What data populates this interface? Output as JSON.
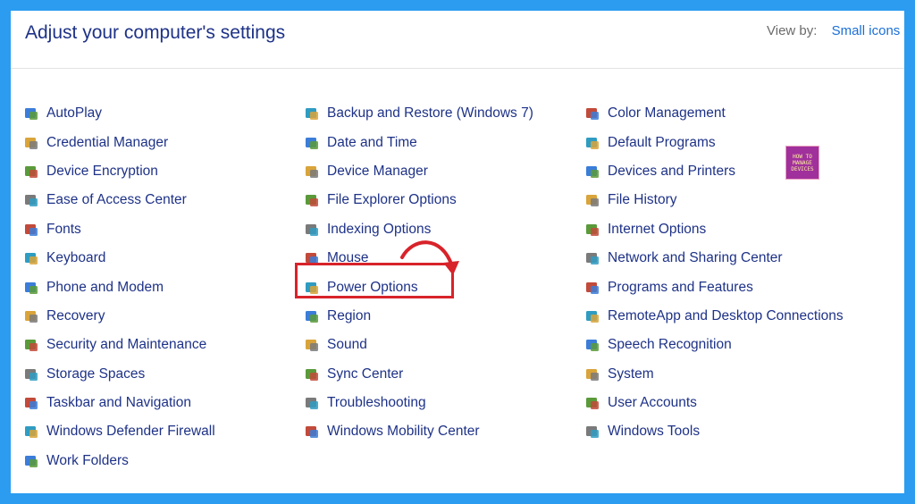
{
  "header": {
    "title": "Adjust your computer's settings",
    "view_by_label": "View by:",
    "view_by_value": "Small icons"
  },
  "columns": [
    [
      {
        "label": "AutoPlay",
        "icon": "autoplay-icon"
      },
      {
        "label": "Credential Manager",
        "icon": "credential-manager-icon"
      },
      {
        "label": "Device Encryption",
        "icon": "device-encryption-icon"
      },
      {
        "label": "Ease of Access Center",
        "icon": "ease-of-access-icon"
      },
      {
        "label": "Fonts",
        "icon": "fonts-icon"
      },
      {
        "label": "Keyboard",
        "icon": "keyboard-icon"
      },
      {
        "label": "Phone and Modem",
        "icon": "phone-modem-icon"
      },
      {
        "label": "Recovery",
        "icon": "recovery-icon"
      },
      {
        "label": "Security and Maintenance",
        "icon": "security-flag-icon"
      },
      {
        "label": "Storage Spaces",
        "icon": "storage-spaces-icon"
      },
      {
        "label": "Taskbar and Navigation",
        "icon": "taskbar-icon"
      },
      {
        "label": "Windows Defender Firewall",
        "icon": "firewall-icon"
      },
      {
        "label": "Work Folders",
        "icon": "work-folders-icon"
      }
    ],
    [
      {
        "label": "Backup and Restore (Windows 7)",
        "icon": "backup-restore-icon"
      },
      {
        "label": "Date and Time",
        "icon": "date-time-icon"
      },
      {
        "label": "Device Manager",
        "icon": "device-manager-icon"
      },
      {
        "label": "File Explorer Options",
        "icon": "file-explorer-options-icon"
      },
      {
        "label": "Indexing Options",
        "icon": "indexing-options-icon"
      },
      {
        "label": "Mouse",
        "icon": "mouse-icon"
      },
      {
        "label": "Power Options",
        "icon": "power-options-icon"
      },
      {
        "label": "Region",
        "icon": "region-icon"
      },
      {
        "label": "Sound",
        "icon": "sound-icon"
      },
      {
        "label": "Sync Center",
        "icon": "sync-center-icon"
      },
      {
        "label": "Troubleshooting",
        "icon": "troubleshooting-icon"
      },
      {
        "label": "Windows Mobility Center",
        "icon": "mobility-center-icon"
      }
    ],
    [
      {
        "label": "Color Management",
        "icon": "color-management-icon"
      },
      {
        "label": "Default Programs",
        "icon": "default-programs-icon"
      },
      {
        "label": "Devices and Printers",
        "icon": "devices-printers-icon"
      },
      {
        "label": "File History",
        "icon": "file-history-icon"
      },
      {
        "label": "Internet Options",
        "icon": "internet-options-icon"
      },
      {
        "label": "Network and Sharing Center",
        "icon": "network-sharing-icon"
      },
      {
        "label": "Programs and Features",
        "icon": "programs-features-icon"
      },
      {
        "label": "RemoteApp and Desktop Connections",
        "icon": "remoteapp-icon"
      },
      {
        "label": "Speech Recognition",
        "icon": "speech-recognition-icon"
      },
      {
        "label": "System",
        "icon": "system-icon"
      },
      {
        "label": "User Accounts",
        "icon": "user-accounts-icon"
      },
      {
        "label": "Windows Tools",
        "icon": "windows-tools-icon"
      }
    ]
  ],
  "logo": {
    "lines": [
      "HOW TO",
      "MANAGE",
      "DEVICES"
    ]
  },
  "colors": {
    "link": "#1e3287",
    "accent": "#1a6fd6",
    "highlight": "#d8232a",
    "frame": "#2b9cf0"
  }
}
